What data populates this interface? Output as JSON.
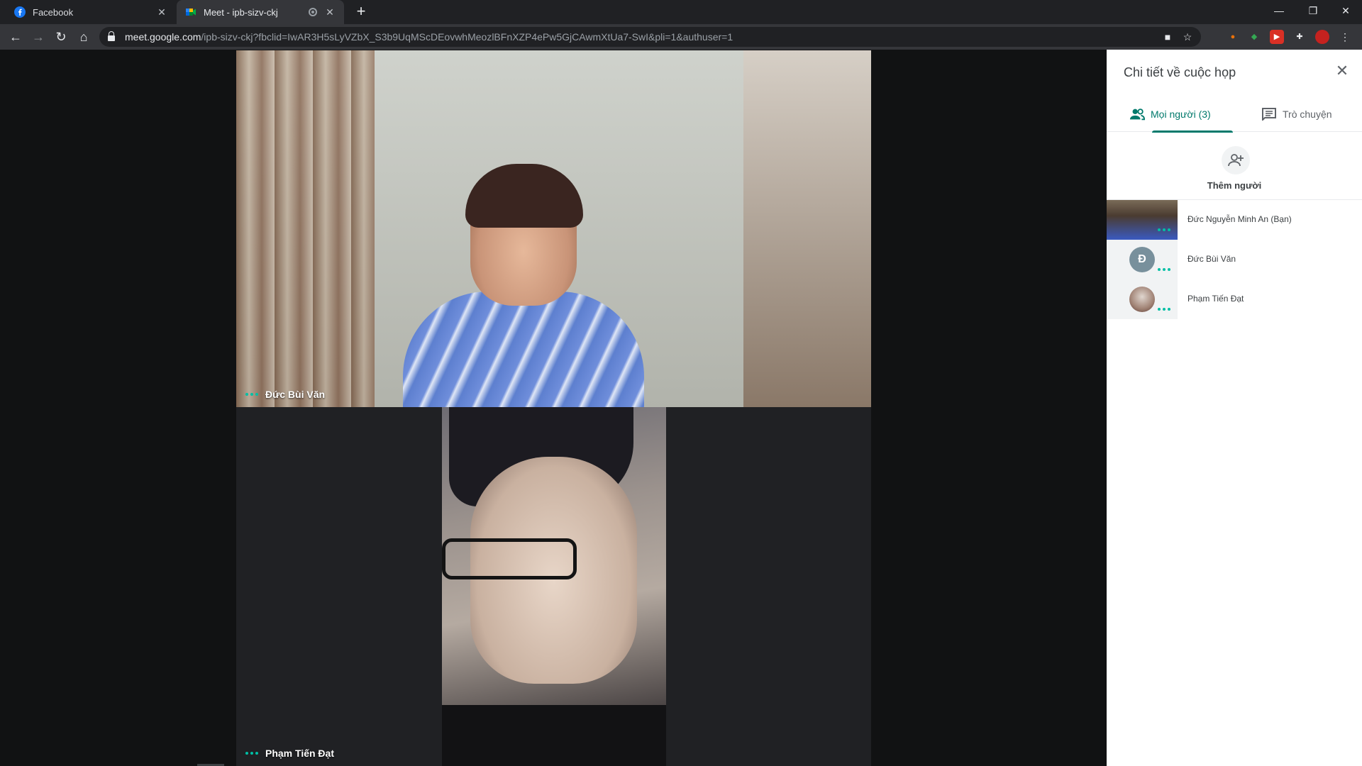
{
  "browser": {
    "tabs": [
      {
        "title": "Facebook",
        "favicon": "facebook-icon",
        "active": false
      },
      {
        "title": "Meet - ipb-sizv-ckj",
        "favicon": "google-meet-icon",
        "active": true
      }
    ],
    "url_domain": "meet.google.com",
    "url_path": "/ipb-sizv-ckj?fbclid=IwAR3H5sLyVZbX_S3b9UqMScDEovwhMeozlBFnXZP4ePw5GjCAwmXtUa7-SwI&pli=1&authuser=1"
  },
  "meeting": {
    "tiles": [
      {
        "name": "Đức Bùi Văn"
      },
      {
        "name": "Phạm Tiến Đạt"
      }
    ]
  },
  "panel": {
    "title": "Chi tiết về cuộc họp",
    "tab_people": "Mọi người (3)",
    "tab_chat": "Trò chuyện",
    "add_people": "Thêm người",
    "participants": [
      {
        "name": "Đức Nguyễn Minh An (Bạn)",
        "avatar": "video"
      },
      {
        "name": "Đức Bùi Văn",
        "avatar": "letter",
        "initial": "Đ"
      },
      {
        "name": "Phạm Tiến Đạt",
        "avatar": "photo"
      }
    ]
  },
  "colors": {
    "accent": "#00796b",
    "speaking_dots": "#00bfa5",
    "stage_bg": "#202124"
  }
}
